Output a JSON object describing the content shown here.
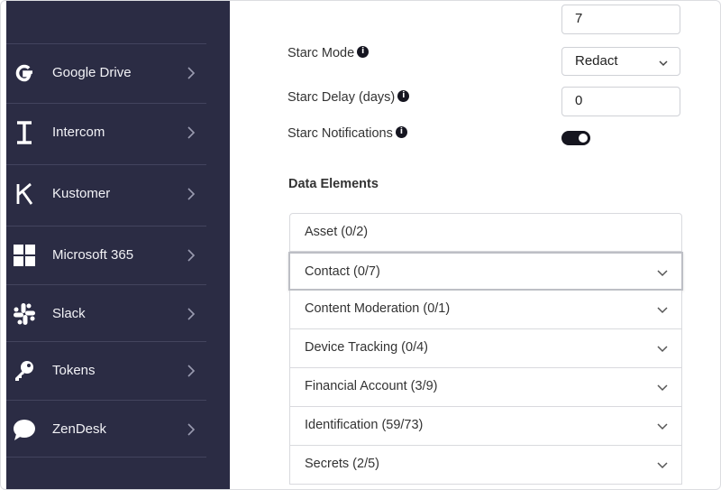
{
  "sidebar": {
    "items": [
      {
        "label": "Google Drive",
        "icon": "google-g-icon"
      },
      {
        "label": "Intercom",
        "icon": "intercom-icon"
      },
      {
        "label": "Kustomer",
        "icon": "kustomer-k-icon"
      },
      {
        "label": "Microsoft 365",
        "icon": "microsoft-windows-icon"
      },
      {
        "label": "Slack",
        "icon": "slack-icon"
      },
      {
        "label": "Tokens",
        "icon": "key-icon"
      },
      {
        "label": "ZenDesk",
        "icon": "chat-bubble-icon"
      }
    ]
  },
  "settings": {
    "top_value": "7",
    "starc_mode": {
      "label": "Starc Mode",
      "value": "Redact"
    },
    "starc_delay": {
      "label": "Starc Delay (days)",
      "value": "0"
    },
    "starc_notifications": {
      "label": "Starc Notifications",
      "enabled": true
    },
    "info_glyph": "i"
  },
  "data_elements": {
    "title": "Data Elements",
    "items": [
      {
        "label": "Asset (0/2)"
      },
      {
        "label": "Contact (0/7)"
      },
      {
        "label": "Content Moderation (0/1)"
      },
      {
        "label": "Device Tracking (0/4)"
      },
      {
        "label": "Financial Account (3/9)"
      },
      {
        "label": "Identification (59/73)"
      },
      {
        "label": "Secrets (2/5)"
      }
    ]
  },
  "colors": {
    "sidebar_bg": "#2b2c44",
    "toggle_on": "#15151f"
  }
}
